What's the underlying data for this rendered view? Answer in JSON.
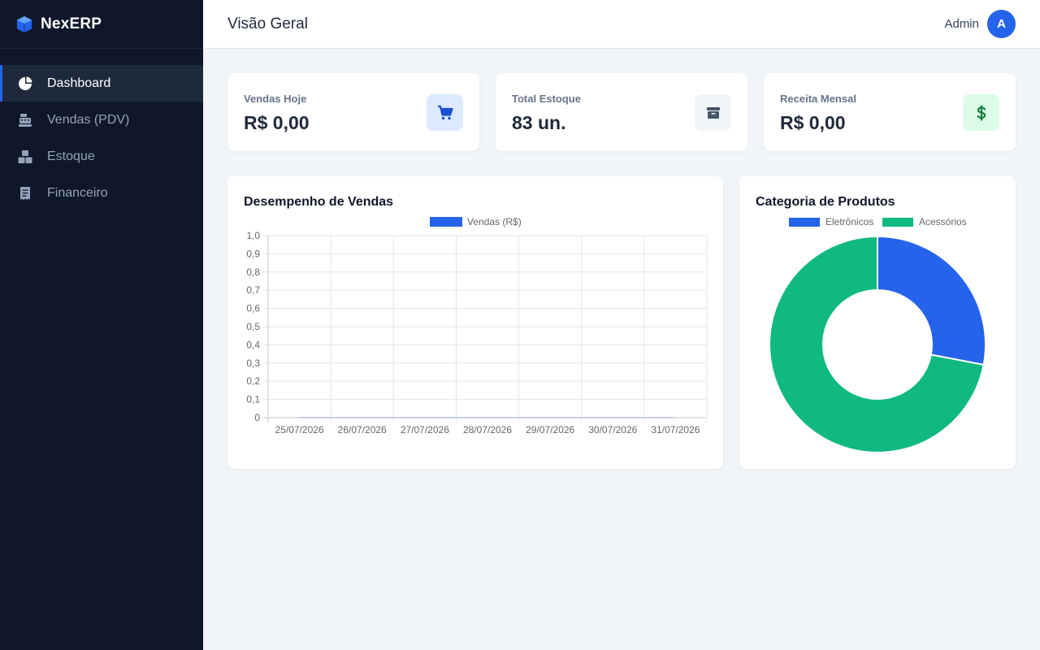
{
  "brand": {
    "name": "NexERP",
    "icon": "cube-icon",
    "color": "#2563eb"
  },
  "sidebar": {
    "items": [
      {
        "label": "Dashboard",
        "icon": "pie-chart-icon",
        "active": true
      },
      {
        "label": "Vendas (PDV)",
        "icon": "cash-register-icon",
        "active": false
      },
      {
        "label": "Estoque",
        "icon": "boxes-icon",
        "active": false
      },
      {
        "label": "Financeiro",
        "icon": "receipt-icon",
        "active": false
      }
    ]
  },
  "header": {
    "title": "Visão Geral",
    "user_name": "Admin",
    "avatar_initial": "A"
  },
  "stats": [
    {
      "label": "Vendas Hoje",
      "value": "R$ 0,00",
      "icon": "cart-icon",
      "icon_color": "#1d4ed8",
      "icon_bg": "#dbeafe"
    },
    {
      "label": "Total Estoque",
      "value": "83 un.",
      "icon": "box-icon",
      "icon_color": "#475569",
      "icon_bg": "#f1f5f9"
    },
    {
      "label": "Receita Mensal",
      "value": "R$ 0,00",
      "icon": "dollar-icon",
      "icon_color": "#15803d",
      "icon_bg": "#dcfce7"
    }
  ],
  "sales_chart": {
    "title": "Desempenho de Vendas",
    "chart_data": {
      "type": "line",
      "categories": [
        "25/07/2026",
        "26/07/2026",
        "27/07/2026",
        "28/07/2026",
        "29/07/2026",
        "30/07/2026",
        "31/07/2026"
      ],
      "series": [
        {
          "name": "Vendas (R$)",
          "values": [
            0,
            0,
            0,
            0,
            0,
            0,
            0
          ],
          "color": "#2563eb"
        }
      ],
      "ylim": [
        0,
        1
      ],
      "yticks": [
        "1,0",
        "0,9",
        "0,8",
        "0,7",
        "0,6",
        "0,5",
        "0,4",
        "0,3",
        "0,2",
        "0,1",
        "0"
      ],
      "legend": "top",
      "grid": true
    }
  },
  "category_chart": {
    "title": "Categoria de Produtos",
    "chart_data": {
      "type": "pie",
      "categories": [
        "Eletrônicos",
        "Acessórios"
      ],
      "values": [
        28,
        72
      ],
      "colors": [
        "#2563eb",
        "#10b981"
      ],
      "donut": true,
      "legend": "top"
    }
  }
}
